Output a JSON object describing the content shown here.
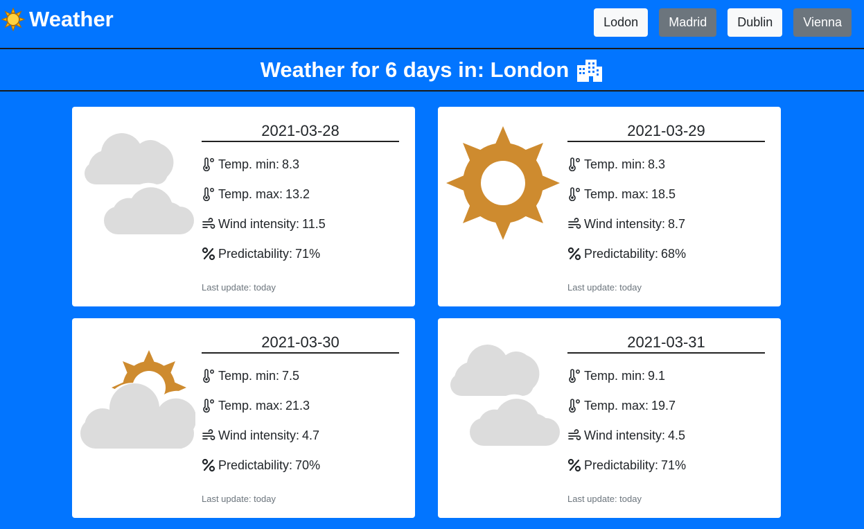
{
  "app": {
    "title": "Weather",
    "logo_icon": "sun-icon"
  },
  "cities": [
    {
      "label": "Lodon",
      "style": "light"
    },
    {
      "label": "Madrid",
      "style": "dark"
    },
    {
      "label": "Dublin",
      "style": "light"
    },
    {
      "label": "Vienna",
      "style": "dark"
    }
  ],
  "headline": {
    "text": "Weather for 6 days in: London",
    "icon": "city-icon"
  },
  "labels": {
    "temp_min": "Temp. min:",
    "temp_max": "Temp. max:",
    "wind": "Wind intensity:",
    "predictability": "Predictability:"
  },
  "days": [
    {
      "date": "2021-03-28",
      "icon": "heavy-cloud-icon",
      "temp_min": "8.3",
      "temp_max": "13.2",
      "wind": "11.5",
      "predictability": "71%",
      "updated": "Last update: today"
    },
    {
      "date": "2021-03-29",
      "icon": "clear-sun-icon",
      "temp_min": "8.3",
      "temp_max": "18.5",
      "wind": "8.7",
      "predictability": "68%",
      "updated": "Last update: today"
    },
    {
      "date": "2021-03-30",
      "icon": "partly-cloudy-icon",
      "temp_min": "7.5",
      "temp_max": "21.3",
      "wind": "4.7",
      "predictability": "70%",
      "updated": "Last update: today"
    },
    {
      "date": "2021-03-31",
      "icon": "heavy-cloud-icon",
      "temp_min": "9.1",
      "temp_max": "19.7",
      "wind": "4.5",
      "predictability": "71%",
      "updated": "Last update: today"
    }
  ],
  "colors": {
    "background": "#0275ff",
    "sun": "#ce8b2f",
    "cloud": "#dcdcdc",
    "button_light": "#f8f9fa",
    "button_dark": "#6c757d"
  }
}
